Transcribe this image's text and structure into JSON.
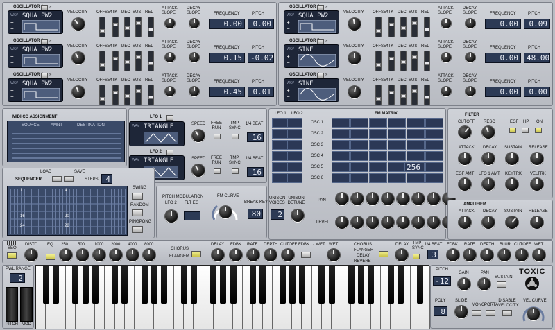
{
  "oscillators": [
    {
      "title": "OSCILLATOR 1",
      "wave": "SQUA PW2",
      "frequency": "0.00",
      "pitch": "0.00"
    },
    {
      "title": "OSCILLATOR 2",
      "wave": "SQUA PW2",
      "frequency": "0.15",
      "pitch": "-0.02"
    },
    {
      "title": "OSCILLATOR 3",
      "wave": "SQUA PW2",
      "frequency": "0.45",
      "pitch": "0.01"
    },
    {
      "title": "OSCILLATOR 4",
      "wave": "SQUA PW2",
      "frequency": "0.00",
      "pitch": "0.09"
    },
    {
      "title": "OSCILLATOR 5",
      "wave": "SINE",
      "frequency": "0.00",
      "pitch": "48.00"
    },
    {
      "title": "OSCILLATOR 6",
      "wave": "SINE",
      "frequency": "0.00",
      "pitch": "0.00"
    }
  ],
  "osc_labels": {
    "wav": "WAV",
    "velocity": "VELOCITY",
    "offset": "OFFSET",
    "atk": "ATK",
    "dec": "DEC",
    "sus": "SUS",
    "rel": "REL",
    "attack_slope": "ATTACK SLOPE",
    "decay_slope": "DECAY SLOPE",
    "frequency": "FREQUENCY",
    "pitch": "PITCH"
  },
  "midi": {
    "title": "MIDI CC ASSIGNMENT",
    "source": "SOURCE",
    "amnt": "AMNT",
    "destination": "DESTINATION"
  },
  "lfo1": {
    "title": "LFO 1",
    "wave": "TRIANGLE",
    "speed": "SPEED",
    "free_run": "FREE RUN",
    "tmp_sync": "TMP SYNC",
    "beat_label": "1/4 BEAT",
    "beat_value": "16"
  },
  "lfo2": {
    "title": "LFO 2",
    "wave": "TRIANGLE",
    "speed": "SPEED",
    "free_run": "FREE RUN",
    "tmp_sync": "TMP SYNC",
    "beat_label": "1/4 BEAT",
    "beat_value": "16"
  },
  "fm": {
    "title": "FM MATRIX",
    "lfo1": "LFO 1",
    "lfo2": "LFO 2",
    "rows": [
      "OSC 1",
      "OSC 2",
      "OSC 3",
      "OSC 4",
      "OSC 5",
      "OSC 6"
    ],
    "value": "256",
    "pan": "PAN",
    "level": "LEVEL"
  },
  "filter": {
    "title": "FILTER",
    "cutoff": "CUTOFF",
    "reso": "RESO",
    "egf": "EGF",
    "hp": "HP",
    "on": "ON",
    "attack": "ATTACK",
    "decay": "DECAY",
    "sustain": "SUSTAIN",
    "release": "RELEASE",
    "egf_amt": "EGF AMT",
    "lfo1_amt": "LFO 1 AMT",
    "keytrk": "KEYTRK",
    "veltrk": "VELTRK"
  },
  "amplifier": {
    "title": "AMPLIFIER",
    "attack": "ATTACK",
    "decay": "DECAY",
    "sustain": "SUSTAIN",
    "release": "RELEASE"
  },
  "sequencer": {
    "title": "SEQUENCER",
    "load": "LOAD",
    "save": "SAVE",
    "steps": "STEPS",
    "steps_value": "4",
    "swing": "SWING",
    "random": "RANDOM",
    "pingpong": "PINGPONG",
    "rows": [
      "1",
      "4",
      "16",
      "20",
      "24",
      "28"
    ]
  },
  "pitchmod": {
    "title": "PITCH MODULATION",
    "lfo2": "LFO 2",
    "flt_eg": "FLT EG",
    "fm_curve": "FM CURVE",
    "break_key": "BREAK KEY",
    "break_value": "80",
    "unison_voices": "UNISON VOICES",
    "unison_value": "2",
    "unison_detune": "UNISON DETUNE"
  },
  "fx": {
    "seq": "SEQ",
    "disto": "DISTO",
    "eq": "EQ",
    "bands": [
      "250",
      "500",
      "1000",
      "2000",
      "4000",
      "8000"
    ],
    "chorus": "CHORUS",
    "flanger": "FLANGER",
    "delay": "DELAY",
    "fdbk": "FDBK",
    "rate": "RATE",
    "depth": "DEPTH",
    "cutoff": "CUTOFF",
    "fdbk_wet": "FDBK → WET",
    "wet": "WET",
    "chorus2": "CHORUS",
    "flanger2": "FLANGER",
    "delay2": "DELAY",
    "reverb": "REVERB",
    "delay3": "DELAY",
    "tmp_sync": "TMP SYNC",
    "beat": "1/4 BEAT",
    "beat_value": "3",
    "fdbk2": "FDBK",
    "rate2": "RATE",
    "depth2": "DEPTH",
    "blur": "BLUR",
    "cutoff2": "CUTOFF",
    "wet2": "WET"
  },
  "bottom": {
    "pwl_range": "PWL RANGE",
    "pwl_value": "2",
    "pitch": "PITCH",
    "mod": "MOD",
    "pitch_label": "PITCH",
    "pitch_value": "-12",
    "gain": "GAIN",
    "pan": "PAN",
    "sustain": "SUSTAIN",
    "poly": "POLY",
    "poly_value": "8",
    "slide": "SLIDE",
    "mono": "MONO",
    "porta": "PORTA",
    "disable_velocity": "DISABLE VELOCITY",
    "vel_curve": "VEL CURVE",
    "logo": "TOXIC"
  },
  "colors": {
    "panel": "#c3c6cc",
    "lcd": "#2c3a55",
    "led_on": "#e8e47a"
  }
}
